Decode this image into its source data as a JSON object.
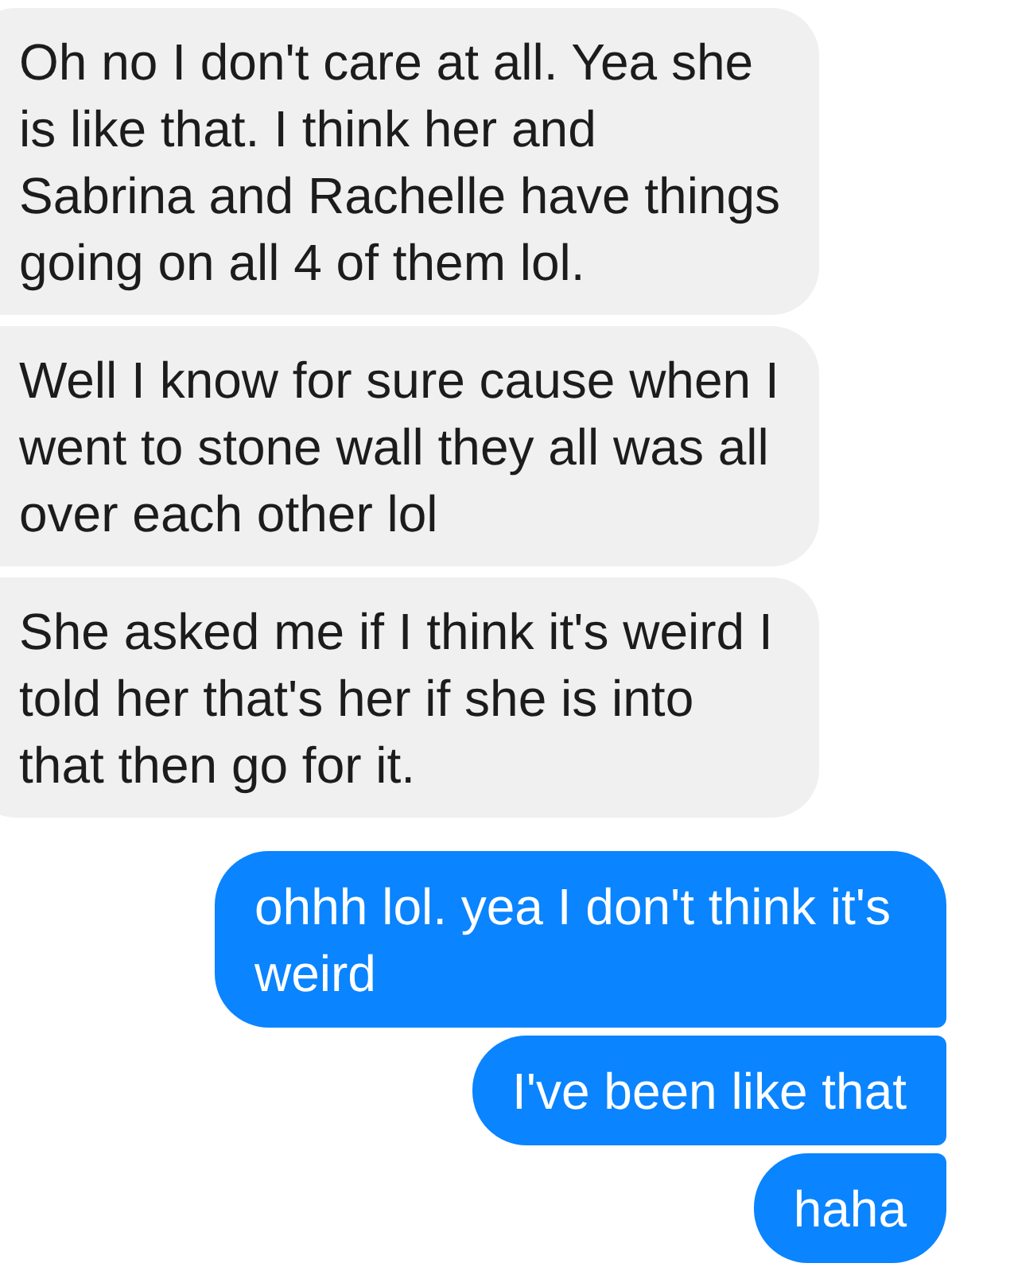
{
  "messages": [
    {
      "kind": "received",
      "text": "Oh no I don't care at all. Yea she is like that. I think her and Sabrina and Rachelle have things going on all 4 of them lol."
    },
    {
      "kind": "received",
      "text": "Well I know for sure cause when I went to stone wall they all was all over each other lol"
    },
    {
      "kind": "received",
      "text": "She asked me if I think it's weird I told her that's her if she is into that then go for it."
    },
    {
      "kind": "sent",
      "text": "ohhh lol. yea I don't think it's weird"
    },
    {
      "kind": "sent",
      "text": "I've been like that"
    },
    {
      "kind": "sent",
      "text": "haha"
    }
  ]
}
